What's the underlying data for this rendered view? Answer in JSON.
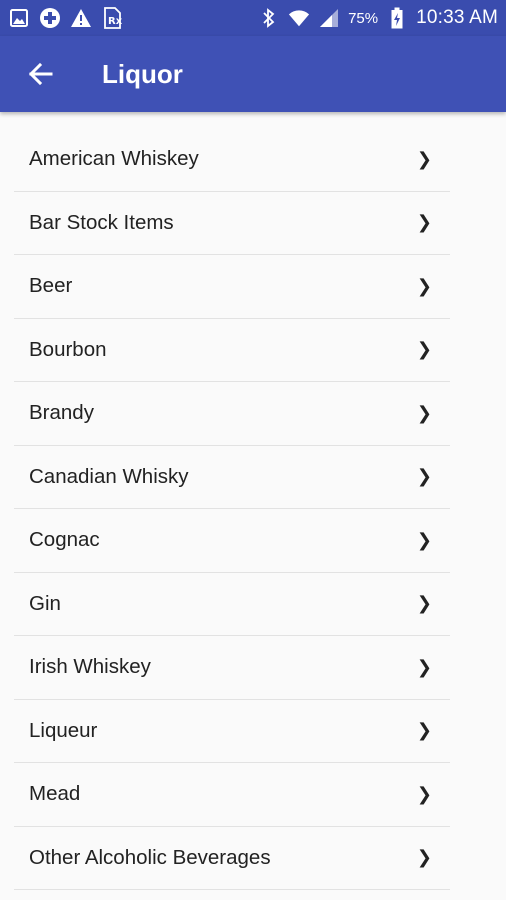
{
  "status_bar": {
    "battery": "75%",
    "time": "10:33 AM",
    "icons": [
      "image-icon",
      "plus-circle-icon",
      "warning-icon",
      "rx-icon",
      "bluetooth-icon",
      "wifi-icon",
      "signal-icon",
      "battery-charging-icon"
    ]
  },
  "app_bar": {
    "back_icon": "arrow-left-icon",
    "title": "Liquor",
    "color": "#3f51b5"
  },
  "categories": [
    {
      "label": "American Whiskey"
    },
    {
      "label": "Bar Stock Items"
    },
    {
      "label": "Beer"
    },
    {
      "label": "Bourbon"
    },
    {
      "label": "Brandy"
    },
    {
      "label": "Canadian Whisky"
    },
    {
      "label": "Cognac"
    },
    {
      "label": "Gin"
    },
    {
      "label": "Irish Whiskey"
    },
    {
      "label": "Liqueur"
    },
    {
      "label": "Mead"
    },
    {
      "label": "Other Alcoholic Beverages"
    }
  ],
  "chevron_glyph": "❯"
}
